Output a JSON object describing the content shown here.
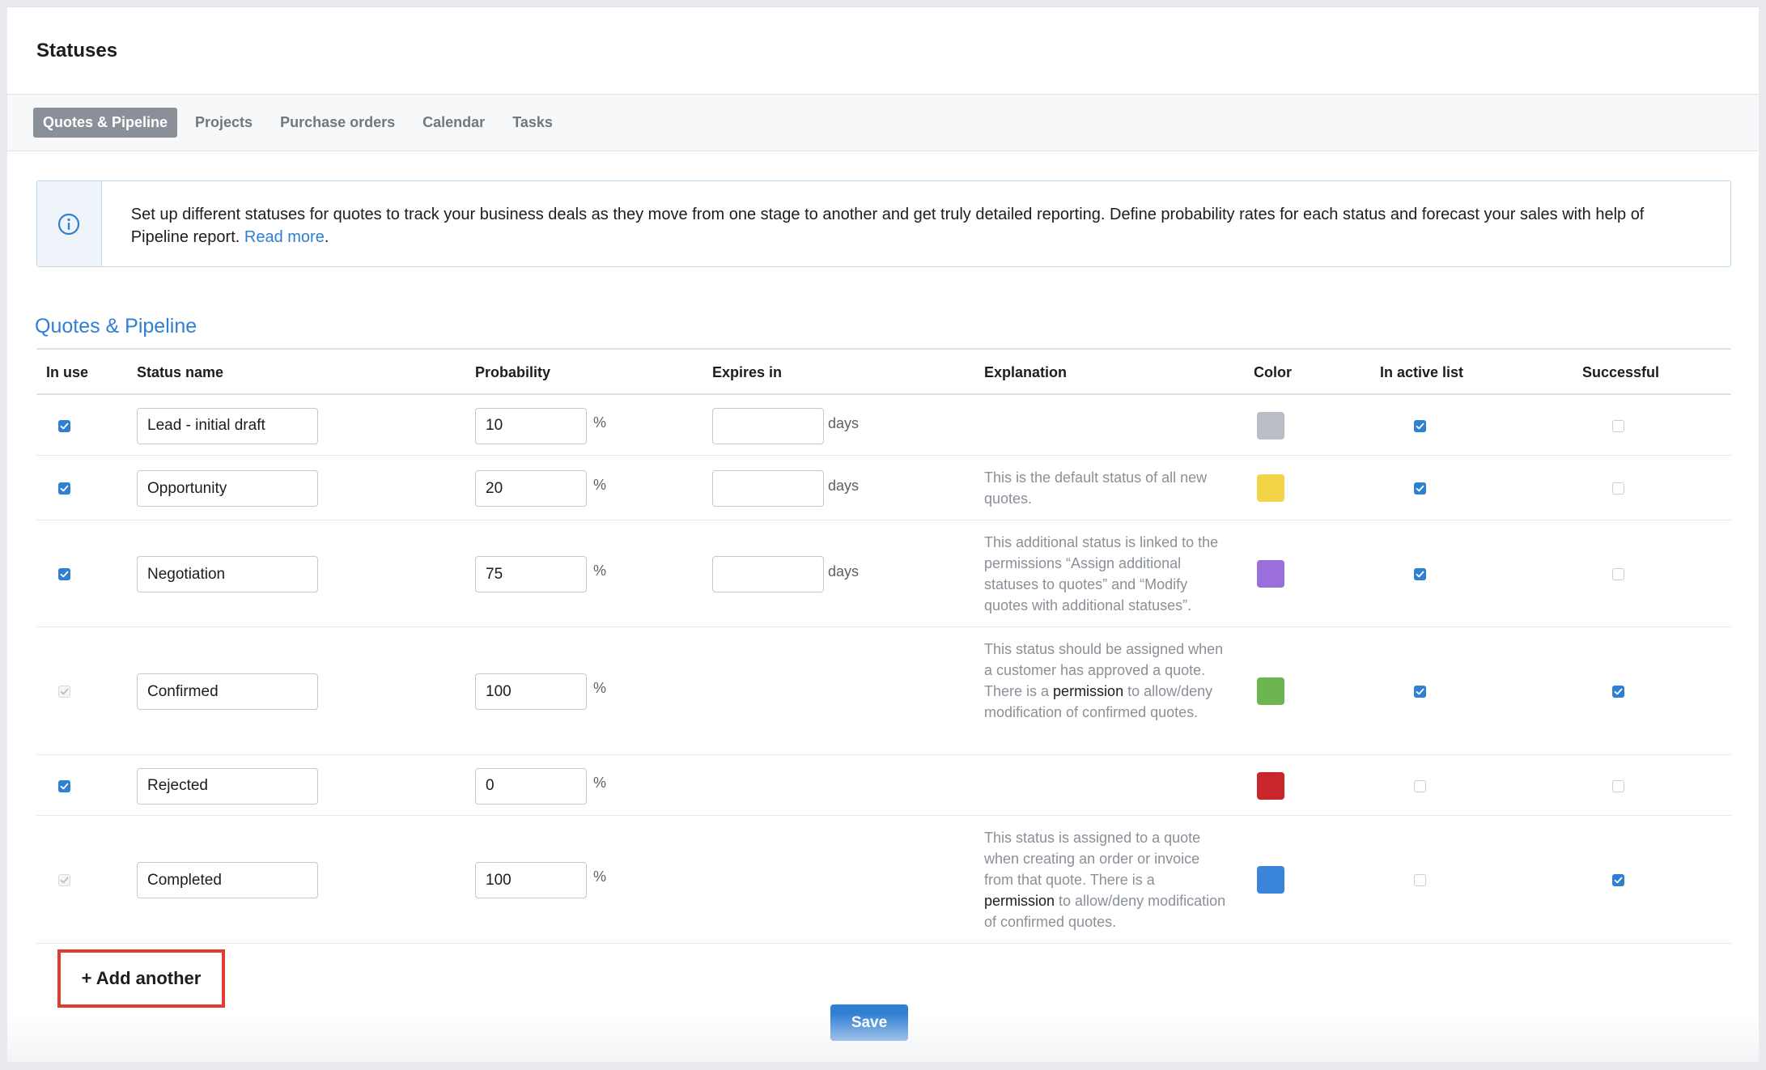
{
  "page": {
    "title": "Statuses"
  },
  "tabs": [
    {
      "label": "Quotes & Pipeline",
      "active": true
    },
    {
      "label": "Projects",
      "active": false
    },
    {
      "label": "Purchase orders",
      "active": false
    },
    {
      "label": "Calendar",
      "active": false
    },
    {
      "label": "Tasks",
      "active": false
    }
  ],
  "info": {
    "icon": "info-circle-icon",
    "text": "Set up different statuses for quotes to track your business deals as they move from one stage to another and get truly detailed reporting. Define probability rates for each status and forecast your sales with help of Pipeline report.",
    "link_label": "Read more",
    "suffix": "."
  },
  "section": {
    "title": "Quotes & Pipeline"
  },
  "table": {
    "headers": {
      "in_use": "In use",
      "status_name": "Status name",
      "probability": "Probability",
      "expires_in": "Expires in",
      "explanation": "Explanation",
      "color": "Color",
      "in_active_list": "In active list",
      "successful": "Successful"
    },
    "units": {
      "percent": "%",
      "days": "days"
    },
    "rows": [
      {
        "in_use": "checked",
        "name": "Lead - initial draft",
        "probability": "10",
        "expires": "",
        "show_expires": true,
        "explanation": [],
        "color": "#b9bec6",
        "in_active_list": "checked",
        "successful": "unchecked"
      },
      {
        "in_use": "checked",
        "name": "Opportunity",
        "probability": "20",
        "expires": "",
        "show_expires": true,
        "explanation": [
          {
            "text": "This is the default status of all new quotes.",
            "dark": false
          }
        ],
        "color": "#f1d547",
        "in_active_list": "checked",
        "successful": "unchecked"
      },
      {
        "in_use": "checked",
        "name": "Negotiation",
        "probability": "75",
        "expires": "",
        "show_expires": true,
        "explanation": [
          {
            "text": "This additional status is linked to the permissions “Assign additional statuses to quotes” and “Modify quotes with additional statuses”.",
            "dark": false
          }
        ],
        "color": "#9a6fdc",
        "in_active_list": "checked",
        "successful": "unchecked"
      },
      {
        "in_use": "disabled",
        "name": "Confirmed",
        "probability": "100",
        "expires": "",
        "show_expires": false,
        "explanation": [
          {
            "text": "This status should be assigned when a customer has approved a quote. There is a ",
            "dark": false
          },
          {
            "text": "permission",
            "dark": true
          },
          {
            "text": " to allow/deny modification of confirmed quotes.",
            "dark": false
          }
        ],
        "color": "#6db550",
        "in_active_list": "checked",
        "successful": "checked"
      },
      {
        "in_use": "checked",
        "name": "Rejected",
        "probability": "0",
        "expires": "",
        "show_expires": false,
        "explanation": [],
        "color": "#c9262c",
        "in_active_list": "unchecked",
        "successful": "unchecked"
      },
      {
        "in_use": "disabled",
        "name": "Completed",
        "probability": "100",
        "expires": "",
        "show_expires": false,
        "explanation": [
          {
            "text": "This status is assigned to a quote when creating an order or invoice from that quote. There is a ",
            "dark": false
          },
          {
            "text": "permission",
            "dark": true
          },
          {
            "text": " to allow/deny modification of confirmed quotes.",
            "dark": false
          }
        ],
        "color": "#3a84db",
        "in_active_list": "unchecked",
        "successful": "checked"
      }
    ]
  },
  "actions": {
    "add_label": "+ Add another",
    "save_label": "Save"
  }
}
